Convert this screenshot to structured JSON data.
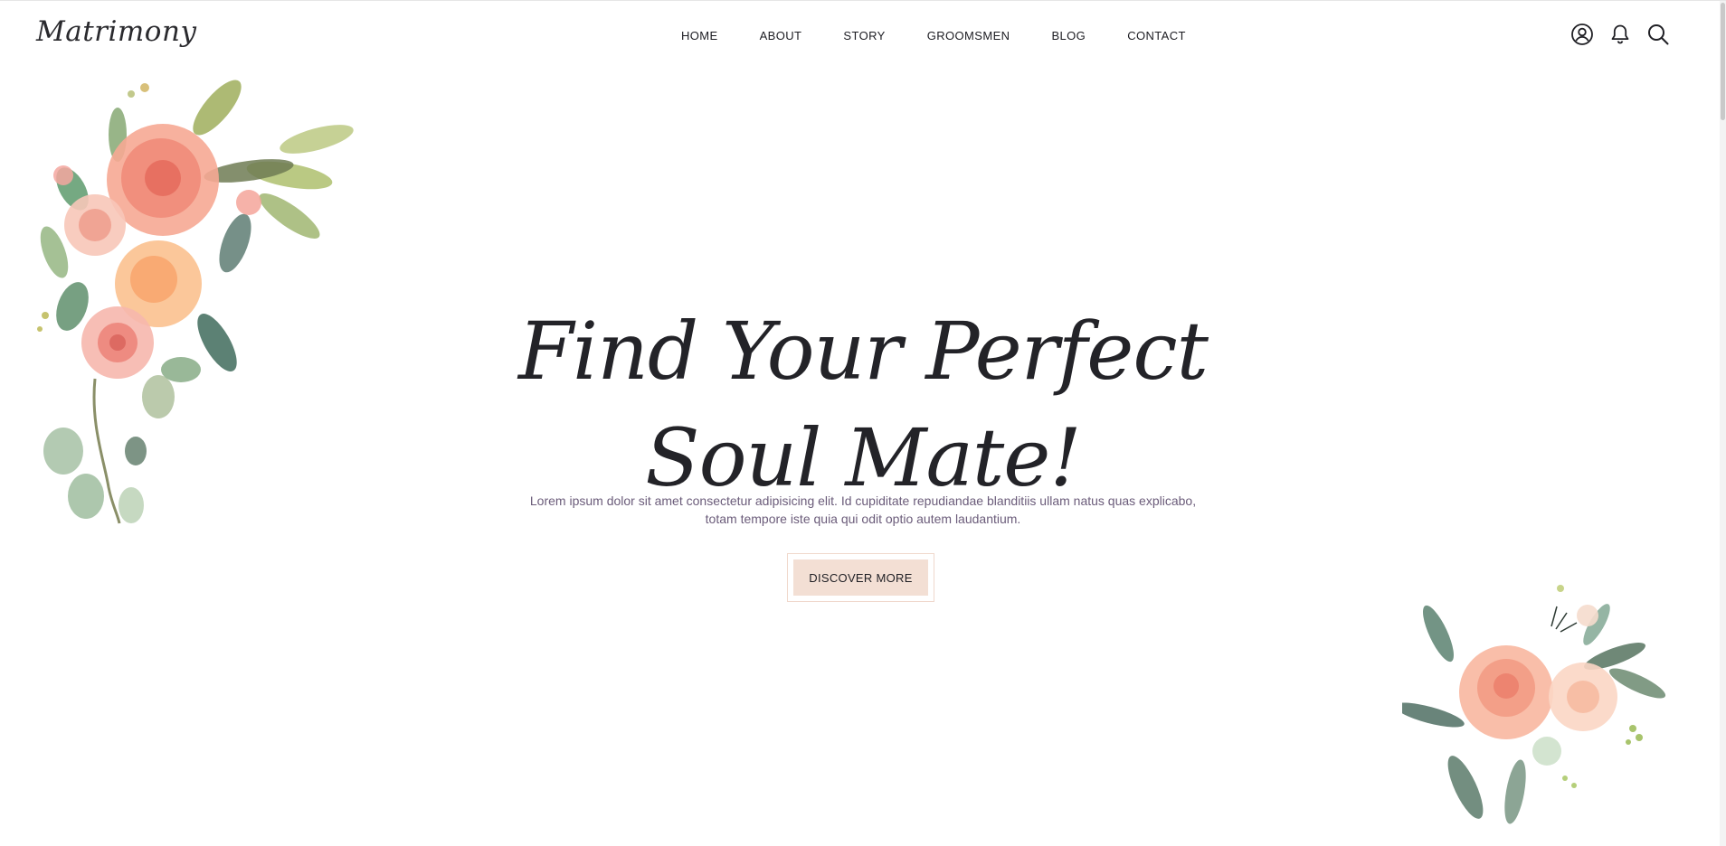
{
  "brand": {
    "logo_text": "Matrimony"
  },
  "nav": {
    "items": [
      {
        "label": "HOME"
      },
      {
        "label": "ABOUT"
      },
      {
        "label": "STORY"
      },
      {
        "label": "GROOMSMEN"
      },
      {
        "label": "BLOG"
      },
      {
        "label": "CONTACT"
      }
    ]
  },
  "header_icons": [
    "user-icon",
    "bell-icon",
    "search-icon"
  ],
  "hero": {
    "title_line1": "Find Your Perfect",
    "title_line2": "Soul Mate!",
    "text_line1": "Lorem ipsum dolor sit amet consectetur adipisicing elit. Id cupiditate repudiandae blanditiis ullam natus quas explicabo,",
    "text_line2": "totam tempore iste quia qui odit optio autem laudantium.",
    "cta_label": "DISCOVER MORE"
  },
  "colors": {
    "accent": "#f3dfd4",
    "text": "#232328",
    "muted": "#6b5c7a",
    "flower_peach": "#f4a48a",
    "flower_coral": "#ee7f6b",
    "leaf_green": "#6f9a7a"
  }
}
